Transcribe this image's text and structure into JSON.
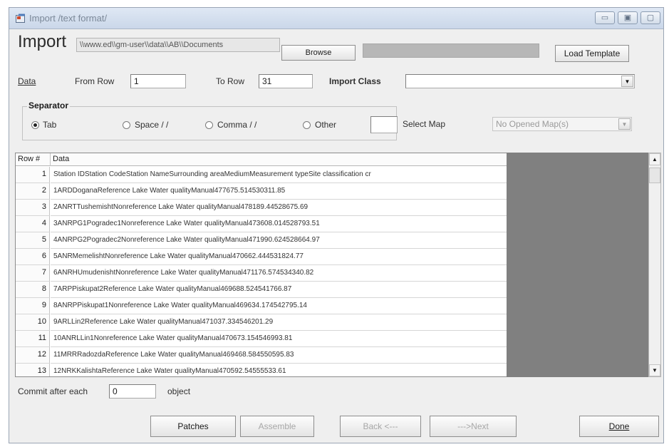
{
  "window": {
    "title": "Import /text format/",
    "controls": [
      "▭",
      "▣",
      "▢"
    ]
  },
  "header": {
    "import_label": "Import",
    "path_value": "\\\\www.ed\\\\gm-user\\\\data\\\\AB\\\\Documents",
    "browse_label": "Browse",
    "progress_fraction": 0.0,
    "load_template_label": "Load Template"
  },
  "data_row": {
    "data_label": "Data",
    "from_row_label": "From Row",
    "from_row_value": "1",
    "to_row_label": "To Row",
    "to_row_value": "31",
    "import_class_label": "Import Class",
    "import_class_value": ""
  },
  "separator": {
    "title": "Separator",
    "options": [
      {
        "label": "Tab",
        "selected": true
      },
      {
        "label": "Space / /",
        "selected": false
      },
      {
        "label": "Comma / /",
        "selected": false
      },
      {
        "label": "Other",
        "selected": false
      }
    ],
    "other_value": "",
    "select_map_label": "Select Map",
    "select_map_value": "No Opened Map(s)"
  },
  "grid": {
    "headers": [
      "Row #",
      "Data"
    ],
    "rows": [
      {
        "n": "1",
        "data": "Station IDStation CodeStation NameSurrounding areaMediumMeasurement typeSite classification cr"
      },
      {
        "n": "2",
        "data": "1ARDDoganaReference Lake Water qualityManual477675.514530311.85"
      },
      {
        "n": "3",
        "data": "2ANRTTushemishtNonreference Lake Water qualityManual478189.44528675.69"
      },
      {
        "n": "4",
        "data": "3ANRPG1Pogradec1Nonreference Lake Water qualityManual473608.014528793.51"
      },
      {
        "n": "5",
        "data": "4ANRPG2Pogradec2Nonreference Lake Water qualityManual471990.624528664.97"
      },
      {
        "n": "6",
        "data": "5ANRMemelishtNonreference Lake Water qualityManual470662.444531824.77"
      },
      {
        "n": "7",
        "data": "6ANRHUmudenishtNonreference Lake Water qualityManual471176.574534340.82"
      },
      {
        "n": "8",
        "data": "7ARPPiskupat2Reference Lake Water qualityManual469688.524541766.87"
      },
      {
        "n": "9",
        "data": "8ANRPPiskupat1Nonreference Lake Water qualityManual469634.174542795.14"
      },
      {
        "n": "10",
        "data": "9ARLLin2Reference Lake Water qualityManual471037.334546201.29"
      },
      {
        "n": "11",
        "data": "10ANRLLin1Nonreference Lake Water qualityManual470673.154546993.81"
      },
      {
        "n": "12",
        "data": "11MRRRadozdaReference Lake Water qualityManual469468.584550595.83"
      },
      {
        "n": "13",
        "data": "12NRKKalishtaReference Lake Water qualityManual470592.54555533.61"
      }
    ]
  },
  "footer": {
    "commit_label": "Commit after each",
    "commit_value": "0",
    "object_label": "object",
    "patches_label": "Patches",
    "assemble_label": "Assemble",
    "back_label": "Back <---",
    "next_label": "--->Next",
    "done_label": "Done"
  }
}
